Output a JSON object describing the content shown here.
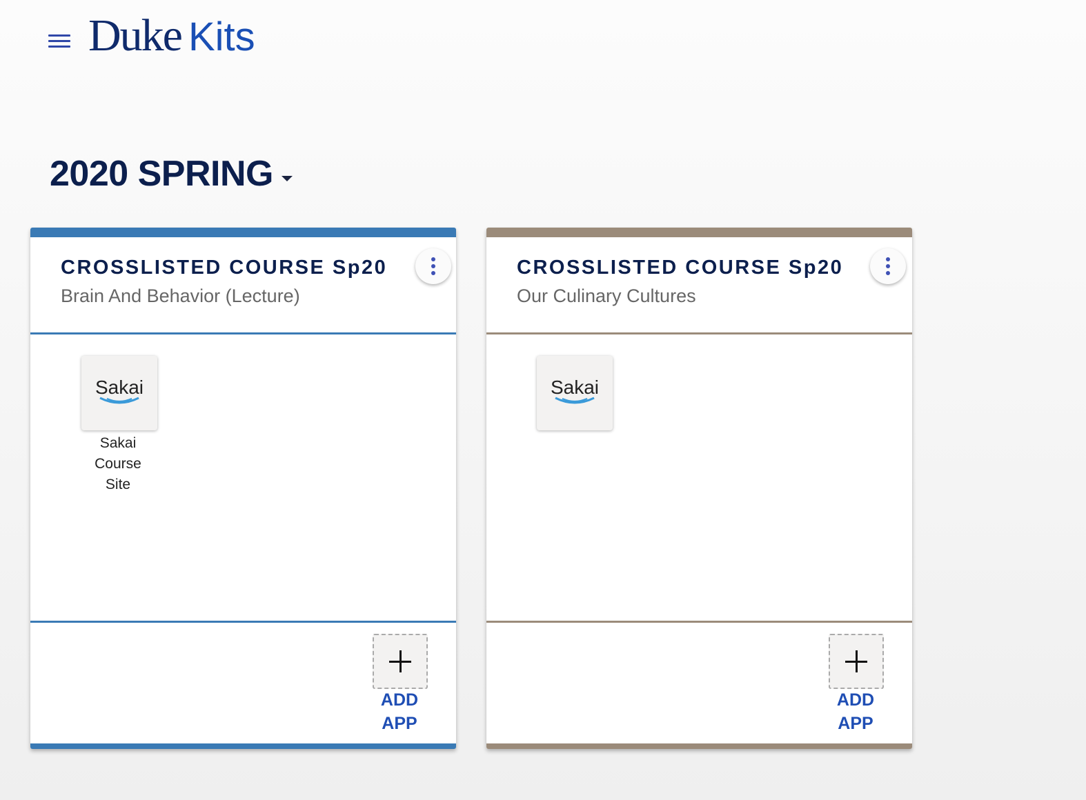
{
  "header": {
    "menu_icon": "hamburger-menu-icon",
    "logo_duke": "Duke",
    "logo_kits": "Kits"
  },
  "term": {
    "label": "2020 SPRING",
    "caret_icon": "caret-down-icon"
  },
  "cards": [
    {
      "title": "CROSSLISTED COURSE Sp20",
      "subtitle": "Brain And Behavior (Lecture)",
      "accent_color": "#3a7ab5",
      "apps": [
        {
          "name": "Sakai",
          "label_lines": [
            "Sakai",
            "Course",
            "Site"
          ]
        }
      ],
      "add_app_lines": [
        "ADD",
        "APP"
      ]
    },
    {
      "title": "CROSSLISTED COURSE Sp20",
      "subtitle": "Our Culinary Cultures",
      "accent_color": "#9b8b7a",
      "apps": [
        {
          "name": "Sakai",
          "label_lines": []
        }
      ],
      "add_app_lines": [
        "ADD",
        "APP"
      ]
    }
  ],
  "colors": {
    "navy": "#0c1f4d",
    "link_blue": "#1f4eb4",
    "kebab_dots": "#3f51b5"
  }
}
